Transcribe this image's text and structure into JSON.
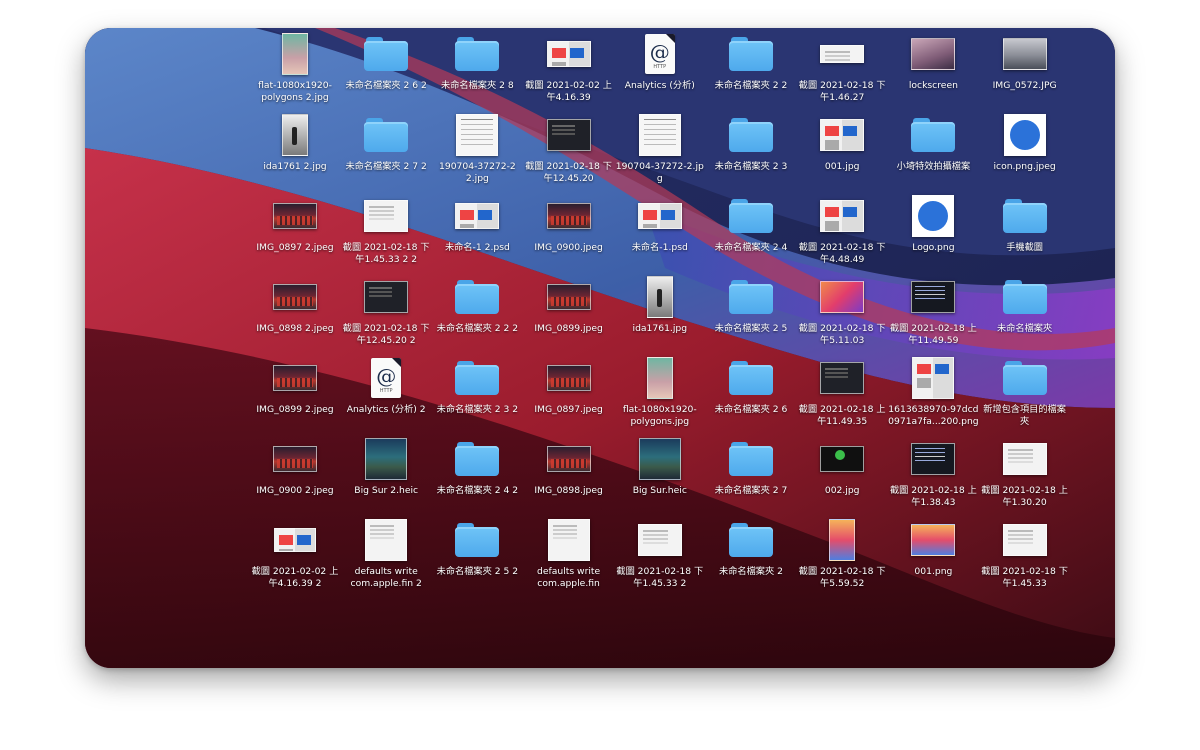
{
  "colors": {
    "page_background": "#ffffff",
    "label_text": "#ffffff",
    "folder": "#5cb3f0",
    "wallpaper_red": "#a8202f",
    "wallpaper_blue": "#3f6fb8",
    "wallpaper_violet": "#6a3aa6"
  },
  "desktop": {
    "items": [
      {
        "col": 0,
        "row": 0,
        "icon": "image-thumbnail",
        "kind": "k-poly t-port",
        "label": "flat-1080x1920-\npolygons 2.jpg"
      },
      {
        "col": 1,
        "row": 0,
        "icon": "folder-icon",
        "label": "未命名檔案夾 2 6 2"
      },
      {
        "col": 2,
        "row": 0,
        "icon": "folder-icon",
        "label": "未命名檔案夾 2 8"
      },
      {
        "col": 3,
        "row": 0,
        "icon": "image-thumbnail",
        "kind": "k-mixed t-wide",
        "label": "截圖 2021-02-02 上\n午4.16.39"
      },
      {
        "col": 4,
        "row": 0,
        "icon": "document-icon",
        "label": "Analytics (分析)"
      },
      {
        "col": 5,
        "row": 0,
        "icon": "folder-icon",
        "label": "未命名檔案夾 2 2"
      },
      {
        "col": 6,
        "row": 0,
        "icon": "image-thumbnail",
        "kind": "k-shot-light t-flat",
        "label": "截圖 2021-02-18 下\n午1.46.27"
      },
      {
        "col": 7,
        "row": 0,
        "icon": "image-thumbnail",
        "kind": "k-lock t-land",
        "label": "lockscreen"
      },
      {
        "col": 8,
        "row": 0,
        "icon": "image-thumbnail",
        "kind": "k-mountain t-land",
        "label": "IMG_0572.JPG"
      },
      {
        "col": 0,
        "row": 1,
        "icon": "image-thumbnail",
        "kind": "k-silhouette t-port",
        "label": "ida1761 2.jpg"
      },
      {
        "col": 1,
        "row": 1,
        "icon": "folder-icon",
        "label": "未命名檔案夾 2 7 2"
      },
      {
        "col": 2,
        "row": 1,
        "icon": "image-thumbnail",
        "kind": "k-chart t-sq",
        "label": "190704-37272-2\n2.jpg"
      },
      {
        "col": 3,
        "row": 1,
        "icon": "image-thumbnail",
        "kind": "k-shot-dark t-land",
        "label": "截圖 2021-02-18 下\n午12.45.20"
      },
      {
        "col": 4,
        "row": 1,
        "icon": "image-thumbnail",
        "kind": "k-chart t-sq",
        "label": "190704-37272-2.jp\ng"
      },
      {
        "col": 5,
        "row": 1,
        "icon": "folder-icon",
        "label": "未命名檔案夾 2 3"
      },
      {
        "col": 6,
        "row": 1,
        "icon": "image-thumbnail",
        "kind": "k-mixed t-land",
        "label": "001.jpg"
      },
      {
        "col": 7,
        "row": 1,
        "icon": "folder-icon",
        "label": "小埼特效拍攝檔案"
      },
      {
        "col": 8,
        "row": 1,
        "icon": "image-thumbnail",
        "kind": "k-logo t-sq",
        "label": "icon.png.jpeg"
      },
      {
        "col": 0,
        "row": 2,
        "icon": "image-thumbnail",
        "kind": "k-photo-red t-wide",
        "label": "IMG_0897 2.jpeg"
      },
      {
        "col": 1,
        "row": 2,
        "icon": "image-thumbnail",
        "kind": "k-shot-light t-land",
        "label": "截圖 2021-02-18 下\n午1.45.33 2 2"
      },
      {
        "col": 2,
        "row": 2,
        "icon": "image-thumbnail",
        "kind": "k-mixed t-wide",
        "label": "未命名-1 2.psd"
      },
      {
        "col": 3,
        "row": 2,
        "icon": "image-thumbnail",
        "kind": "k-photo-red t-wide",
        "label": "IMG_0900.jpeg"
      },
      {
        "col": 4,
        "row": 2,
        "icon": "image-thumbnail",
        "kind": "k-mixed t-wide",
        "label": "未命名-1.psd"
      },
      {
        "col": 5,
        "row": 2,
        "icon": "folder-icon",
        "label": "未命名檔案夾 2 4"
      },
      {
        "col": 6,
        "row": 2,
        "icon": "image-thumbnail",
        "kind": "k-mixed t-land",
        "label": "截圖 2021-02-18 下\n午4.48.49"
      },
      {
        "col": 7,
        "row": 2,
        "icon": "image-thumbnail",
        "kind": "k-logo t-sq",
        "label": "Logo.png"
      },
      {
        "col": 8,
        "row": 2,
        "icon": "folder-icon",
        "label": "手機截圖"
      },
      {
        "col": 0,
        "row": 3,
        "icon": "image-thumbnail",
        "kind": "k-photo-red t-wide",
        "label": "IMG_0898 2.jpeg"
      },
      {
        "col": 1,
        "row": 3,
        "icon": "image-thumbnail",
        "kind": "k-shot-dark t-land",
        "label": "截圖 2021-02-18 下\n午12.45.20 2"
      },
      {
        "col": 2,
        "row": 3,
        "icon": "folder-icon",
        "label": "未命名檔案夾 2 2 2"
      },
      {
        "col": 3,
        "row": 3,
        "icon": "image-thumbnail",
        "kind": "k-photo-red t-wide",
        "label": "IMG_0899.jpeg"
      },
      {
        "col": 4,
        "row": 3,
        "icon": "image-thumbnail",
        "kind": "k-silhouette t-port",
        "label": "ida1761.jpg"
      },
      {
        "col": 5,
        "row": 3,
        "icon": "folder-icon",
        "label": "未命名檔案夾 2 5"
      },
      {
        "col": 6,
        "row": 3,
        "icon": "image-thumbnail",
        "kind": "k-mac t-land",
        "label": "截圖 2021-02-18 下\n午5.11.03"
      },
      {
        "col": 7,
        "row": 3,
        "icon": "image-thumbnail",
        "kind": "k-terminal t-land",
        "label": "截圖 2021-02-18 上\n午11.49.59"
      },
      {
        "col": 8,
        "row": 3,
        "icon": "folder-icon",
        "label": "未命名檔案夾"
      },
      {
        "col": 0,
        "row": 4,
        "icon": "image-thumbnail",
        "kind": "k-photo-red t-wide",
        "label": "IMG_0899 2.jpeg"
      },
      {
        "col": 1,
        "row": 4,
        "icon": "document-icon",
        "label": "Analytics (分析) 2"
      },
      {
        "col": 2,
        "row": 4,
        "icon": "folder-icon",
        "label": "未命名檔案夾 2 3 2"
      },
      {
        "col": 3,
        "row": 4,
        "icon": "image-thumbnail",
        "kind": "k-photo-red t-wide",
        "label": "IMG_0897.jpeg"
      },
      {
        "col": 4,
        "row": 4,
        "icon": "image-thumbnail",
        "kind": "k-poly t-port",
        "label": "flat-1080x1920-\npolygons.jpg"
      },
      {
        "col": 5,
        "row": 4,
        "icon": "folder-icon",
        "label": "未命名檔案夾 2 6"
      },
      {
        "col": 6,
        "row": 4,
        "icon": "image-thumbnail",
        "kind": "k-shot-dark t-land",
        "label": "截圖 2021-02-18 上\n午11.49.35"
      },
      {
        "col": 7,
        "row": 4,
        "icon": "image-thumbnail",
        "kind": "k-mixed t-sq",
        "label": "1613638970-97dcd\n0971a7fa...200.png"
      },
      {
        "col": 8,
        "row": 4,
        "icon": "folder-icon",
        "label": "新增包含項目的檔案\n夾"
      },
      {
        "col": 0,
        "row": 5,
        "icon": "image-thumbnail",
        "kind": "k-photo-red t-wide",
        "label": "IMG_0900 2.jpeg"
      },
      {
        "col": 1,
        "row": 5,
        "icon": "image-thumbnail",
        "kind": "k-bigsur t-sq",
        "label": "Big Sur 2.heic"
      },
      {
        "col": 2,
        "row": 5,
        "icon": "folder-icon",
        "label": "未命名檔案夾 2 4 2"
      },
      {
        "col": 3,
        "row": 5,
        "icon": "image-thumbnail",
        "kind": "k-photo-red t-wide",
        "label": "IMG_0898.jpeg"
      },
      {
        "col": 4,
        "row": 5,
        "icon": "image-thumbnail",
        "kind": "k-bigsur t-sq",
        "label": "Big Sur.heic"
      },
      {
        "col": 5,
        "row": 5,
        "icon": "folder-icon",
        "label": "未命名檔案夾 2 7"
      },
      {
        "col": 6,
        "row": 5,
        "icon": "image-thumbnail",
        "kind": "k-apple t-wide",
        "label": "002.jpg"
      },
      {
        "col": 7,
        "row": 5,
        "icon": "image-thumbnail",
        "kind": "k-terminal t-land",
        "label": "截圖 2021-02-18 上\n午1.38.43"
      },
      {
        "col": 8,
        "row": 5,
        "icon": "image-thumbnail",
        "kind": "k-shot-light t-land",
        "label": "截圖 2021-02-18 上\n午1.30.20"
      },
      {
        "col": 0,
        "row": 6,
        "icon": "image-thumbnail",
        "kind": "k-mixed t-wide2",
        "label": "截圖 2021-02-02 上\n午4.16.39 2"
      },
      {
        "col": 1,
        "row": 6,
        "icon": "image-thumbnail",
        "kind": "k-shot-light t-sq",
        "label": "defaults write\ncom.apple.fin 2"
      },
      {
        "col": 2,
        "row": 6,
        "icon": "folder-icon",
        "label": "未命名檔案夾 2 5 2"
      },
      {
        "col": 3,
        "row": 6,
        "icon": "image-thumbnail",
        "kind": "k-shot-light t-sq",
        "label": "defaults write\ncom.apple.fin"
      },
      {
        "col": 4,
        "row": 6,
        "icon": "image-thumbnail",
        "kind": "k-shot-light t-land",
        "label": "截圖 2021-02-18 下\n午1.45.33 2"
      },
      {
        "col": 5,
        "row": 6,
        "icon": "folder-icon",
        "label": "未命名檔案夾 2"
      },
      {
        "col": 6,
        "row": 6,
        "icon": "image-thumbnail",
        "kind": "k-iphone t-port",
        "label": "截圖 2021-02-18 下\n午5.59.52"
      },
      {
        "col": 7,
        "row": 6,
        "icon": "image-thumbnail",
        "kind": "k-iphone t-land",
        "label": "001.png"
      },
      {
        "col": 8,
        "row": 6,
        "icon": "image-thumbnail",
        "kind": "k-shot-light t-land",
        "label": "截圖 2021-02-18 下\n午1.45.33"
      }
    ],
    "document_glyph": "@",
    "document_caption": "HTTP"
  }
}
